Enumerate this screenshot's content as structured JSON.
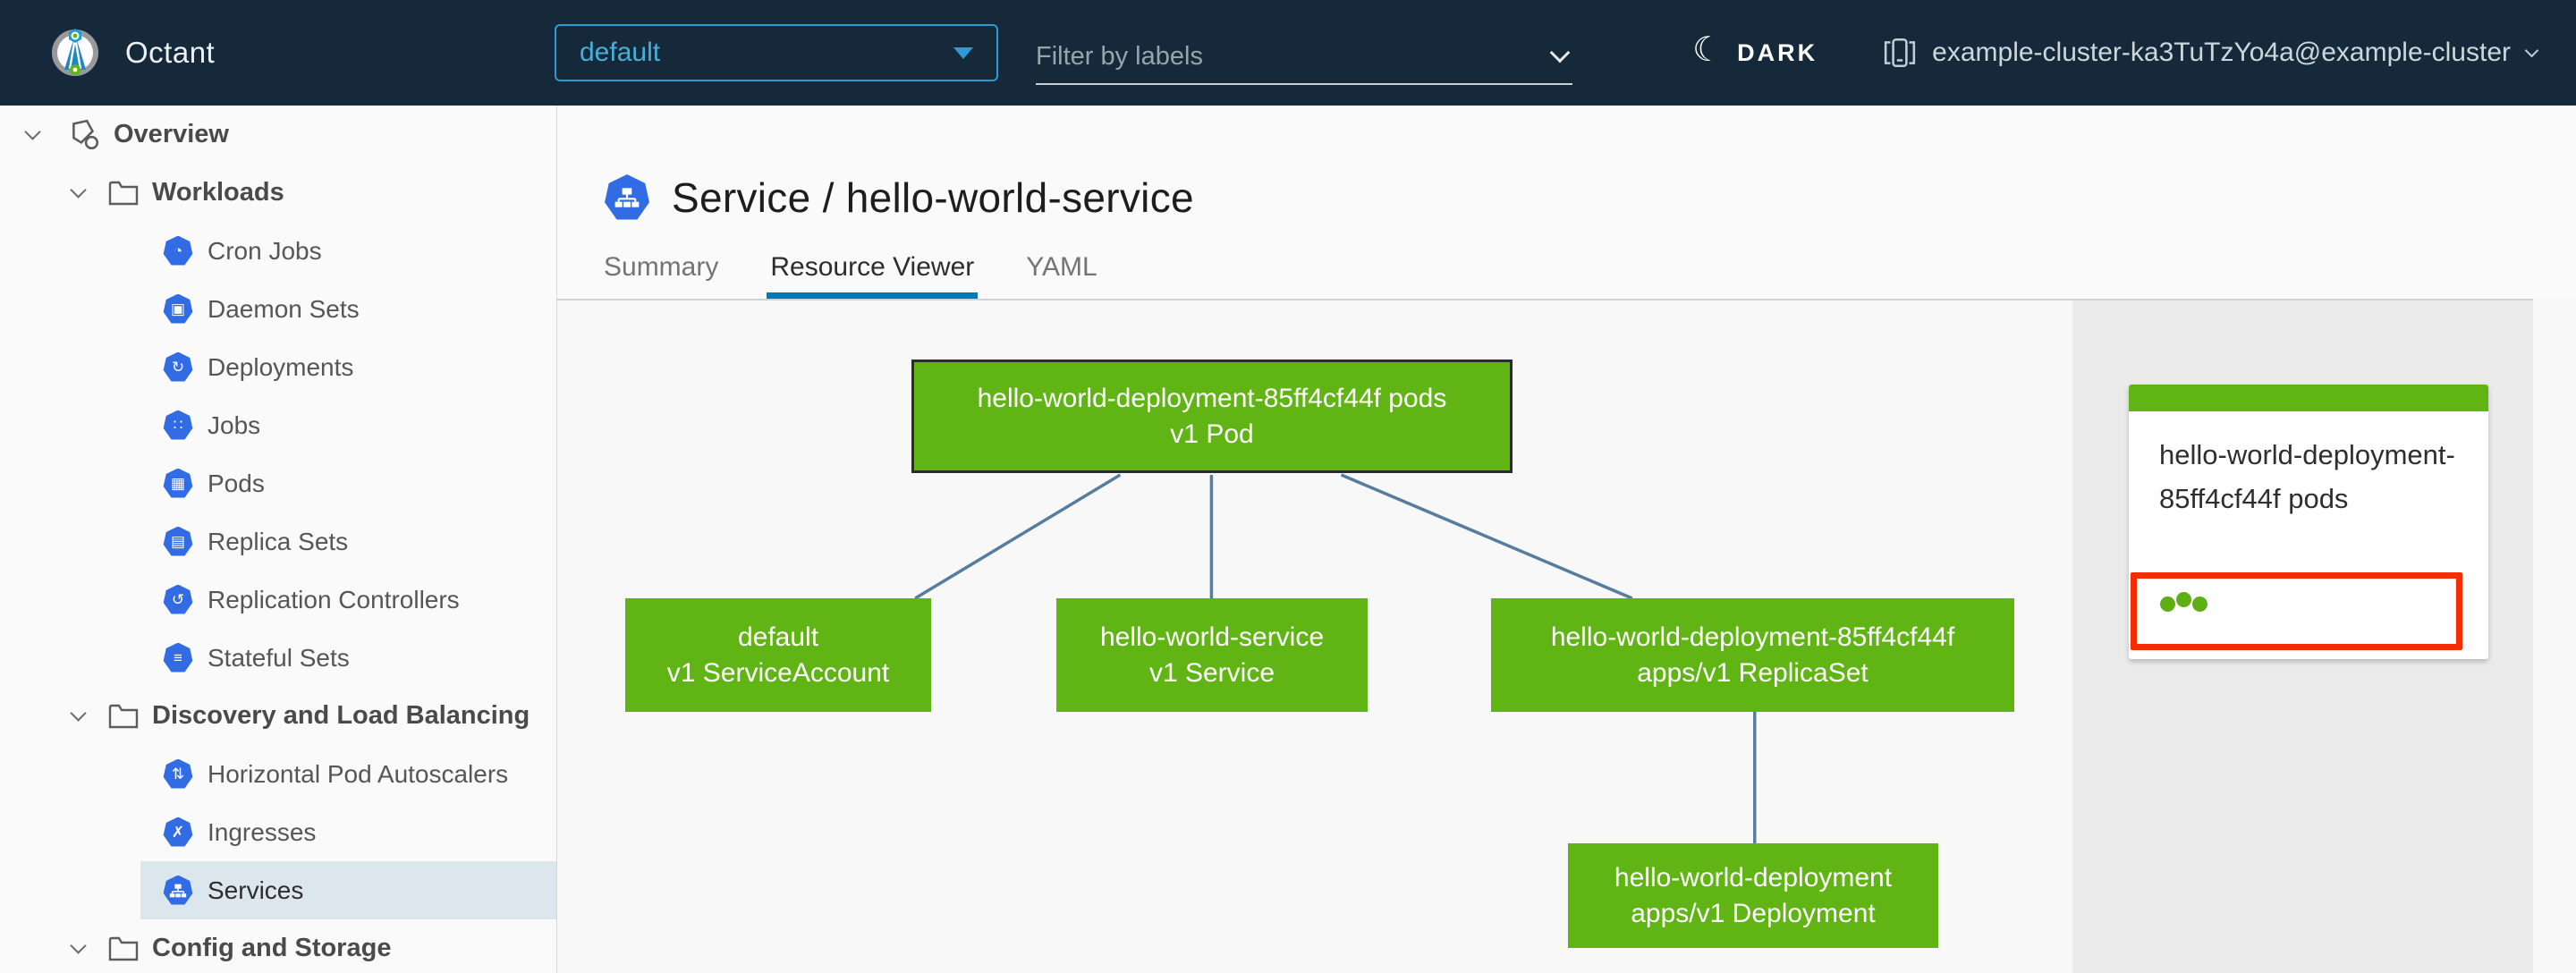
{
  "colors": {
    "navbar_bg": "#16293a",
    "accent_blue": "#0079b8",
    "k8s_icon_blue": "#326ce5",
    "node_green": "#60b515",
    "alert_red": "#f42e00",
    "edge_blue": "#567d9e",
    "selected_row_bg": "#dce6ed"
  },
  "header": {
    "app_name": "Octant",
    "namespace_dropdown": {
      "value": "default"
    },
    "label_filter": {
      "placeholder": "Filter by labels"
    },
    "theme_toggle_label": "DARK",
    "cluster_selector": {
      "value": "example-cluster-ka3TuTzYo4a@example-cluster"
    }
  },
  "icons": {
    "moon": "☾",
    "cronjobs": "◔",
    "daemonsets": "▣",
    "deployments": "↻",
    "jobs": "∷",
    "pods": "▦",
    "replicasets": "▤",
    "replicationcontrollers": "↺",
    "statefulsets": "≡",
    "horizontalpodautoscalers": "⇅",
    "ingresses": "✗"
  },
  "sidebar": {
    "items": [
      {
        "label": "Overview",
        "level": 0,
        "kind": "root",
        "icon": "objects",
        "expanded": true,
        "selected": false
      },
      {
        "label": "Workloads",
        "level": 1,
        "kind": "group",
        "icon": "folder",
        "expanded": true,
        "selected": false
      },
      {
        "label": "Cron Jobs",
        "level": 2,
        "kind": "leaf",
        "icon": "cronjobs",
        "selected": false
      },
      {
        "label": "Daemon Sets",
        "level": 2,
        "kind": "leaf",
        "icon": "daemonsets",
        "selected": false
      },
      {
        "label": "Deployments",
        "level": 2,
        "kind": "leaf",
        "icon": "deployments",
        "selected": false
      },
      {
        "label": "Jobs",
        "level": 2,
        "kind": "leaf",
        "icon": "jobs",
        "selected": false
      },
      {
        "label": "Pods",
        "level": 2,
        "kind": "leaf",
        "icon": "pods",
        "selected": false
      },
      {
        "label": "Replica Sets",
        "level": 2,
        "kind": "leaf",
        "icon": "replicasets",
        "selected": false
      },
      {
        "label": "Replication Controllers",
        "level": 2,
        "kind": "leaf",
        "icon": "replicationcontrollers",
        "selected": false
      },
      {
        "label": "Stateful Sets",
        "level": 2,
        "kind": "leaf",
        "icon": "statefulsets",
        "selected": false
      },
      {
        "label": "Discovery and Load Balancing",
        "level": 1,
        "kind": "group",
        "icon": "folder",
        "expanded": true,
        "selected": false
      },
      {
        "label": "Horizontal Pod Autoscalers",
        "level": 2,
        "kind": "leaf",
        "icon": "horizontalpodautoscalers",
        "selected": false
      },
      {
        "label": "Ingresses",
        "level": 2,
        "kind": "leaf",
        "icon": "ingresses",
        "selected": false
      },
      {
        "label": "Services",
        "level": 2,
        "kind": "leaf",
        "icon": "services",
        "selected": true
      },
      {
        "label": "Config and Storage",
        "level": 1,
        "kind": "group",
        "icon": "folder",
        "expanded": true,
        "selected": false
      }
    ]
  },
  "main": {
    "page_title": "Service / hello-world-service",
    "tabs": [
      {
        "label": "Summary",
        "active": false
      },
      {
        "label": "Resource Viewer",
        "active": true
      },
      {
        "label": "YAML",
        "active": false
      }
    ]
  },
  "graph": {
    "nodes": [
      {
        "id": "pods",
        "line1": "hello-world-deployment-85ff4cf44f pods",
        "line2": "v1 Pod",
        "selected": true
      },
      {
        "id": "serviceaccount",
        "line1": "default",
        "line2": "v1 ServiceAccount",
        "selected": false
      },
      {
        "id": "service",
        "line1": "hello-world-service",
        "line2": "v1 Service",
        "selected": false
      },
      {
        "id": "replicaset",
        "line1": "hello-world-deployment-85ff4cf44f",
        "line2": "apps/v1 ReplicaSet",
        "selected": false
      },
      {
        "id": "deployment",
        "line1": "hello-world-deployment",
        "line2": "apps/v1 Deployment",
        "selected": false
      }
    ],
    "edges": [
      [
        "pods",
        "serviceaccount"
      ],
      [
        "pods",
        "service"
      ],
      [
        "pods",
        "replicaset"
      ],
      [
        "replicaset",
        "deployment"
      ]
    ]
  },
  "detail_card": {
    "title": "hello-world-deployment-85ff4cf44f pods",
    "pod_status_count": 3
  }
}
